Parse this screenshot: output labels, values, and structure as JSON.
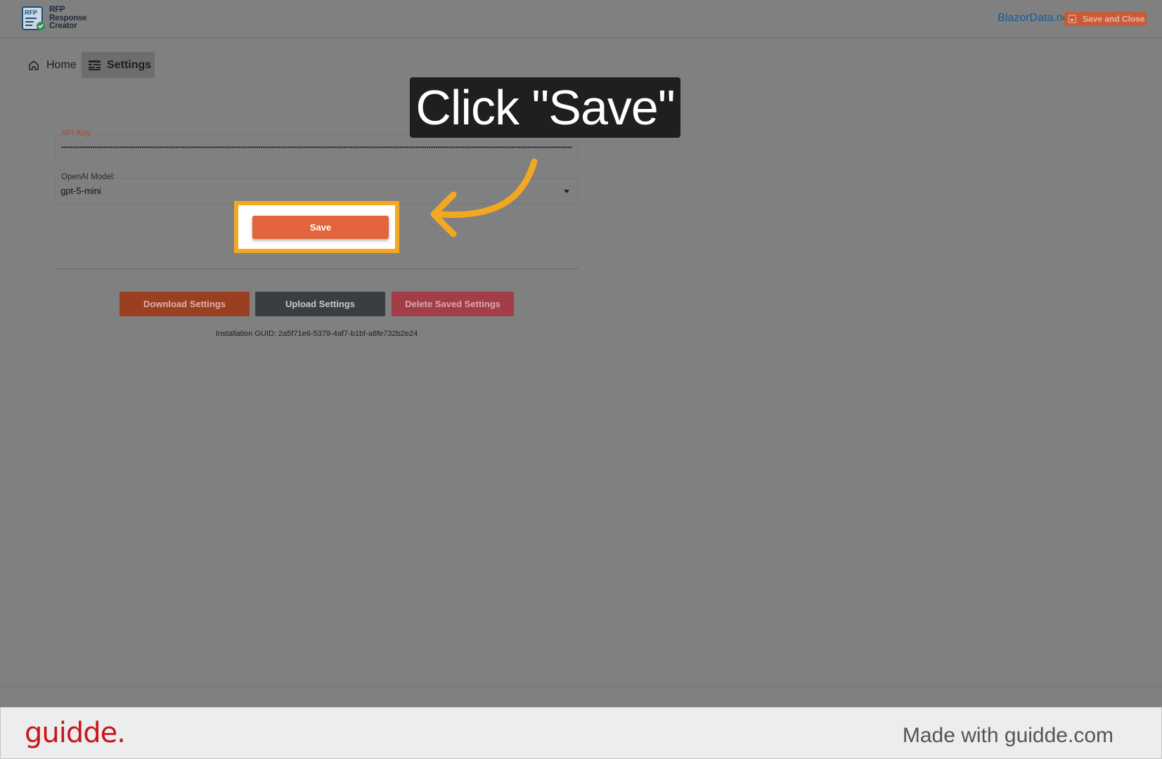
{
  "header": {
    "logo_badge": "RFP",
    "logo_lines": [
      "RFP",
      "Response",
      "Creator"
    ],
    "link_text": "BlazorData.net",
    "save_close_label": "Save and Close"
  },
  "nav": {
    "items": [
      {
        "label": "Home",
        "icon": "home-icon"
      },
      {
        "label": "Settings",
        "icon": "settings-icon",
        "active": true
      }
    ]
  },
  "form": {
    "api_key": {
      "label": "API Key:",
      "value_masked": true
    },
    "model": {
      "label": "OpenAI Model:",
      "value": "gpt-5-mini"
    },
    "save_label": "Save"
  },
  "actions": {
    "download_label": "Download Settings",
    "upload_label": "Upload Settings",
    "delete_label": "Delete Saved Settings"
  },
  "guid_text": "Installation GUID: 2a5f71e6-5379-4af7-b1bf-a8fe732b2e24",
  "overlay": {
    "callout": "Click \"Save\"",
    "accent": "#f3a821"
  },
  "guidde": {
    "logo": "guidde.",
    "made_with": "Made with guidde.com"
  },
  "colors": {
    "primary_button": "#e2643b",
    "link": "#1a5a93",
    "brand_red": "#c9161a"
  }
}
